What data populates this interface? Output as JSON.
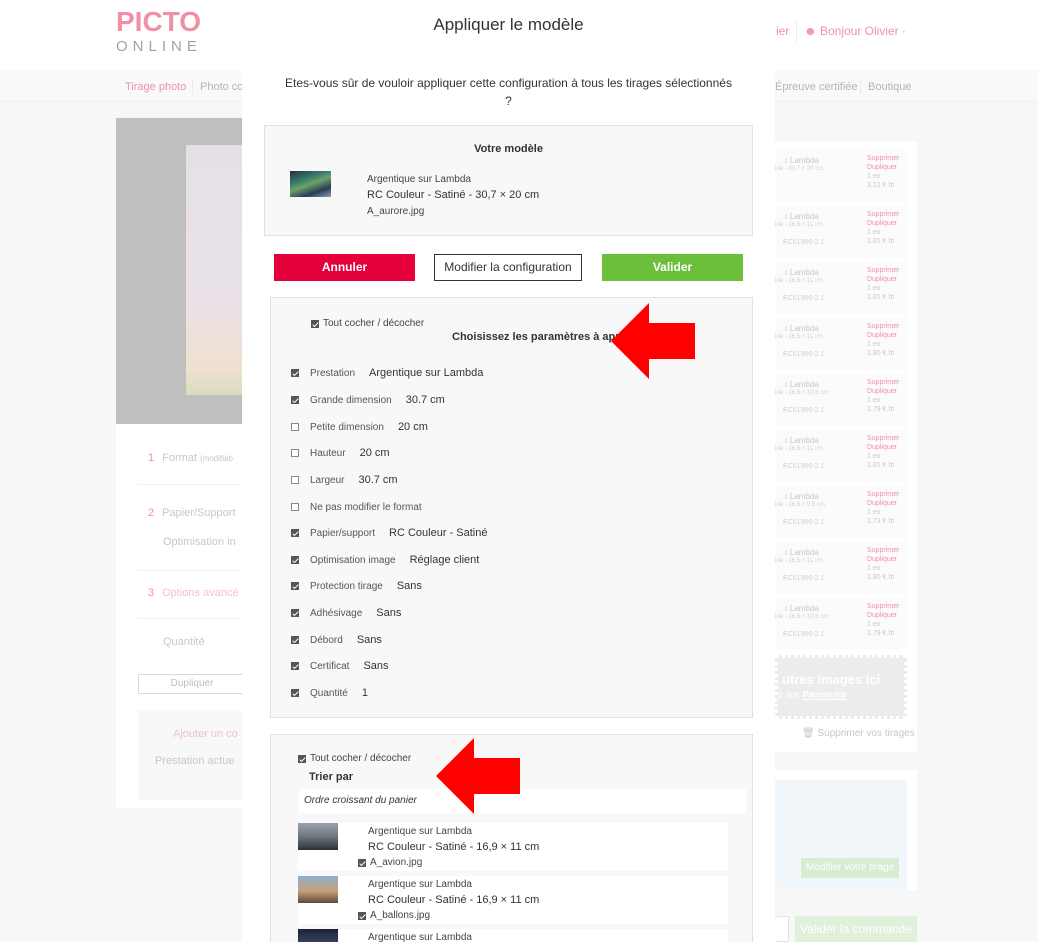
{
  "background": {
    "logo": {
      "top": "PICTO",
      "bottom": "ONLINE"
    },
    "header": {
      "cart_fragment": "ier",
      "user_greeting": "Bonjour Olivier"
    },
    "nav": [
      {
        "label": "Tirage photo",
        "active": true
      },
      {
        "label": "Photo co",
        "active": false
      },
      {
        "label": "Épreuve certifiée",
        "active": false
      },
      {
        "label": "Boutique",
        "active": false
      }
    ],
    "steps": [
      {
        "num": "1",
        "label": "Format",
        "hint": "(modifiab"
      },
      {
        "num": "2",
        "label": "Papier/Support",
        "sub": "Optimisation in"
      },
      {
        "num": "3",
        "label": "Options avancé"
      },
      {
        "label": "Quantité"
      }
    ],
    "duplicate_label": "Dupliquer",
    "add_label": "Ajouter un co",
    "current_label": "Prestation actue",
    "cart_rows": [
      {
        "t1": "r Lambda",
        "t2": "iné - 30,7 × 20 cm",
        "t3": "",
        "qty": "1 ex",
        "price": "3,12 € ht"
      },
      {
        "t1": "r Lambda",
        "t2": "iné - 16,9 × 11 cm",
        "t3": "EC61966-2.1",
        "qty": "1 ex",
        "price": "1,81 € ht"
      },
      {
        "t1": "r Lambda",
        "t2": "iné - 16,9 × 11 cm",
        "t3": "EC61966-2.1",
        "qty": "1 ex",
        "price": "1,81 € ht"
      },
      {
        "t1": "r Lambda",
        "t2": "iné - 16,5 × 11 cm",
        "t3": "EC61966-2.1",
        "qty": "1 ex",
        "price": "1,80 € ht"
      },
      {
        "t1": "r Lambda",
        "t2": "iné - 16,9 × 10,6 cm",
        "t3": "EC61966-2.1",
        "qty": "1 ex",
        "price": "1,79 € ht"
      },
      {
        "t1": "r Lambda",
        "t2": "iné - 16,9 × 11 cm",
        "t3": "EC61966-2.1",
        "qty": "1 ex",
        "price": "1,81 € ht"
      },
      {
        "t1": "r Lambda",
        "t2": "iné - 16,9 × 9,5 cm",
        "t3": "EC61966-2.1",
        "qty": "1 ex",
        "price": "1,73 € ht"
      },
      {
        "t1": "r Lambda",
        "t2": "iné - 16,5 × 11 cm",
        "t3": "EC61966-2.1",
        "qty": "1 ex",
        "price": "1,80 € ht"
      },
      {
        "t1": "r Lambda",
        "t2": "iné - 16,9 × 10,6 cm",
        "t3": "EC61966-2.1",
        "qty": "1 ex",
        "price": "1,79 € ht"
      }
    ],
    "row_actions": {
      "delete": "Supprimer",
      "duplicate": "Dupliquer"
    },
    "drop_big": "utres images ici",
    "drop_small_prefix": "z sur ",
    "drop_small_link": "Parcourir",
    "delete_all": "Supprimer vos tirages",
    "promo_button": "Modifier votre tirage",
    "validate_order": "Valider la commande"
  },
  "modal": {
    "title": "Appliquer le modèle",
    "question": "Etes-vous sûr de vouloir appliquer cette configuration à tous les tirages sélectionnés ?",
    "model": {
      "heading": "Votre modèle",
      "line1": "Argentique sur Lambda",
      "line2": "RC Couleur - Satiné - 30,7 × 20 cm",
      "line3": "A_aurore.jpg"
    },
    "buttons": {
      "cancel": "Annuler",
      "modify": "Modifier la configuration",
      "validate": "Valider"
    },
    "params": {
      "toggle_all": "Tout cocher / décocher",
      "heading": "Choisissez les paramètres à appliquer",
      "rows": [
        {
          "label": "Prestation",
          "value": "Argentique sur Lambda",
          "checked": true
        },
        {
          "label": "Grande dimension",
          "value": "30.7 cm",
          "checked": true
        },
        {
          "label": "Petite dimension",
          "value": "20 cm",
          "checked": false
        },
        {
          "label": "Hauteur",
          "value": "20 cm",
          "checked": false
        },
        {
          "label": "Largeur",
          "value": "30.7 cm",
          "checked": false
        },
        {
          "label": "Ne pas modifier le format",
          "value": "",
          "checked": false
        },
        {
          "label": "Papier/support",
          "value": "RC Couleur - Satiné",
          "checked": true
        },
        {
          "label": "Optimisation image",
          "value": "Réglage client",
          "checked": true
        },
        {
          "label": "Protection tirage",
          "value": "Sans",
          "checked": true
        },
        {
          "label": "Adhésivage",
          "value": "Sans",
          "checked": true
        },
        {
          "label": "Débord",
          "value": "Sans",
          "checked": true
        },
        {
          "label": "Certificat",
          "value": "Sans",
          "checked": true
        },
        {
          "label": "Quantité",
          "value": "1",
          "checked": true
        }
      ]
    },
    "sort": {
      "toggle_all": "Tout cocher / décocher",
      "heading": "Trier par",
      "selected": "Ordre croissant du panier",
      "images": [
        {
          "line1": "Argentique sur Lambda",
          "line2": "RC Couleur - Satiné - 16,9 × 11 cm",
          "file": "A_avion.jpg",
          "checked": true
        },
        {
          "line1": "Argentique sur Lambda",
          "line2": "RC Couleur - Satiné - 16,9 × 11 cm",
          "file": "A_ballons.jpg",
          "checked": true
        },
        {
          "line1": "Argentique sur Lambda",
          "line2": "",
          "file": "",
          "checked": true
        }
      ]
    }
  },
  "colors": {
    "brand": "#e5335c",
    "cancel": "#e4003a",
    "validate": "#6cbf3a",
    "arrow": "#ff0000"
  }
}
